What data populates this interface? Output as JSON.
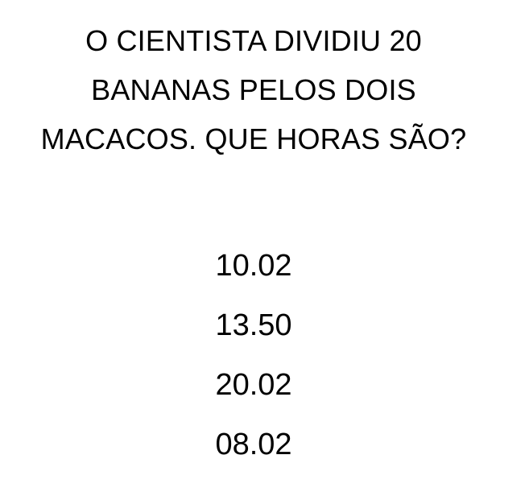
{
  "question": {
    "lines": [
      "O CIENTISTA DIVIDIU 20",
      "BANANAS PELOS DOIS",
      "MACACOS. QUE HORAS SÃO?"
    ]
  },
  "options": [
    "10.02",
    "13.50",
    "20.02",
    "08.02"
  ]
}
